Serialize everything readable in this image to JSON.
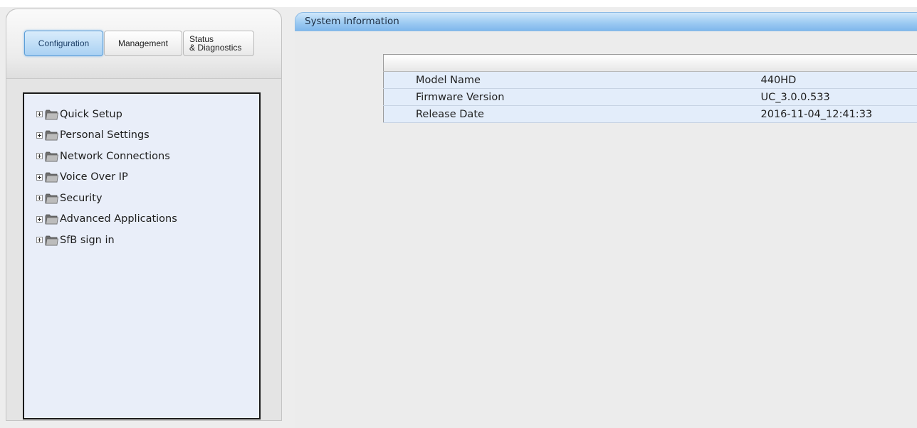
{
  "tabs": {
    "configuration": "Configuration",
    "management": "Management",
    "status_line1": "Status",
    "status_line2": "& Diagnostics"
  },
  "tree": {
    "items": [
      {
        "label": "Quick Setup",
        "icon": "folder-icon"
      },
      {
        "label": "Personal Settings",
        "icon": "folder-icon"
      },
      {
        "label": "Network Connections",
        "icon": "folder-icon"
      },
      {
        "label": "Voice Over IP",
        "icon": "folder-icon"
      },
      {
        "label": "Security",
        "icon": "folder-icon"
      },
      {
        "label": "Advanced Applications",
        "icon": "folder-icon"
      },
      {
        "label": "SfB sign in",
        "icon": "folder-icon"
      }
    ]
  },
  "main": {
    "section_title": "System Information",
    "table": {
      "rows": [
        {
          "label": "Model Name",
          "value": "440HD"
        },
        {
          "label": "Firmware Version",
          "value": "UC_3.0.0.533"
        },
        {
          "label": "Release Date",
          "value": "2016-11-04_12:41:33"
        }
      ]
    }
  },
  "colors": {
    "accent": "#9ecbf2",
    "tree_background": "#e9eef9",
    "table_row": "#e3edfa"
  }
}
